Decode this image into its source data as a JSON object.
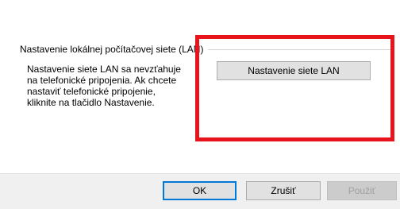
{
  "dialog": {
    "lan_group": {
      "title": "Nastavenie lokálnej počítačovej siete (LAN)",
      "description_lines": [
        "Nastavenie siete LAN sa nevzťahuje",
        "na telefonické pripojenia. Ak chcete",
        "nastaviť telefonické pripojenie,",
        "kliknite na tlačidlo Nastavenie."
      ],
      "button_label": "Nastavenie siete LAN"
    },
    "highlight_color": "#e8141c"
  },
  "footer": {
    "ok_label": "OK",
    "cancel_label": "Zrušiť",
    "apply_label": "Použiť"
  }
}
